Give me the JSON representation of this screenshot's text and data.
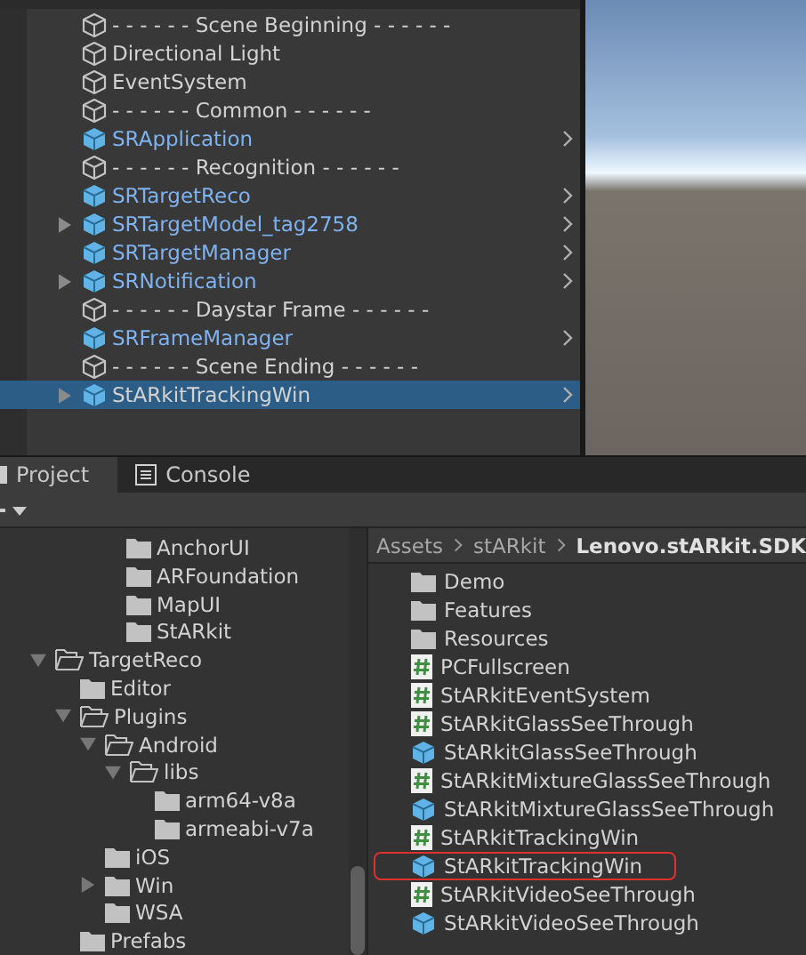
{
  "hierarchy": {
    "items": [
      {
        "label": "- - - - - - Scene Beginning - - - - - -",
        "kind": "object",
        "has_children": false,
        "selected": false
      },
      {
        "label": "Directional Light",
        "kind": "object",
        "has_children": false,
        "selected": false
      },
      {
        "label": "EventSystem",
        "kind": "object",
        "has_children": false,
        "selected": false
      },
      {
        "label": "- - - - - - Common - - - - - -",
        "kind": "object",
        "has_children": false,
        "selected": false
      },
      {
        "label": "SRApplication",
        "kind": "prefab",
        "has_children": false,
        "selected": false
      },
      {
        "label": "- - - - - - Recognition - - - - - -",
        "kind": "object",
        "has_children": false,
        "selected": false
      },
      {
        "label": "SRTargetReco",
        "kind": "prefab",
        "has_children": false,
        "selected": false
      },
      {
        "label": "SRTargetModel_tag2758",
        "kind": "prefab",
        "has_children": true,
        "selected": false
      },
      {
        "label": "SRTargetManager",
        "kind": "prefab",
        "has_children": false,
        "selected": false
      },
      {
        "label": "SRNotification",
        "kind": "prefab",
        "has_children": true,
        "selected": false
      },
      {
        "label": "- - - - - - Daystar Frame - - - - - -",
        "kind": "object",
        "has_children": false,
        "selected": false
      },
      {
        "label": "SRFrameManager",
        "kind": "prefab",
        "has_children": false,
        "selected": false
      },
      {
        "label": "- - - - - - Scene Ending - - - - - -",
        "kind": "object",
        "has_children": false,
        "selected": false
      },
      {
        "label": "StARkitTrackingWin",
        "kind": "prefab",
        "has_children": true,
        "selected": true
      }
    ]
  },
  "tabs": [
    {
      "label": "Project",
      "selected": true
    },
    {
      "label": "Console",
      "selected": false
    }
  ],
  "folder_tree": [
    {
      "label": "AnchorUI",
      "expanded": false,
      "has_children": false
    },
    {
      "label": "ARFoundation",
      "expanded": false,
      "has_children": false
    },
    {
      "label": "MapUI",
      "expanded": false,
      "has_children": false
    },
    {
      "label": "StARkit",
      "expanded": false,
      "has_children": false
    },
    {
      "label": "TargetReco",
      "expanded": true,
      "has_children": true,
      "outdent": true,
      "children": [
        {
          "label": "Editor",
          "expanded": false,
          "has_children": false
        },
        {
          "label": "Plugins",
          "expanded": true,
          "has_children": true,
          "children": [
            {
              "label": "Android",
              "expanded": true,
              "has_children": true,
              "children": [
                {
                  "label": "libs",
                  "expanded": true,
                  "has_children": true,
                  "children": [
                    {
                      "label": "arm64-v8a",
                      "expanded": false,
                      "has_children": false
                    },
                    {
                      "label": "armeabi-v7a",
                      "expanded": false,
                      "has_children": false
                    }
                  ]
                }
              ]
            },
            {
              "label": "iOS",
              "expanded": false,
              "has_children": false
            },
            {
              "label": "Win",
              "expanded": false,
              "has_children": true
            },
            {
              "label": "WSA",
              "expanded": false,
              "has_children": false
            }
          ]
        },
        {
          "label": "Prefabs",
          "expanded": false,
          "has_children": false
        }
      ]
    }
  ],
  "breadcrumb": [
    {
      "label": "Assets",
      "current": false
    },
    {
      "label": "stARkit",
      "current": false
    },
    {
      "label": "Lenovo.stARkit.SDK",
      "current": true
    }
  ],
  "files": [
    {
      "label": "Demo",
      "kind": "folder",
      "highlighted": false
    },
    {
      "label": "Features",
      "kind": "folder",
      "highlighted": false
    },
    {
      "label": "Resources",
      "kind": "folder",
      "highlighted": false
    },
    {
      "label": "PCFullscreen",
      "kind": "script",
      "highlighted": false
    },
    {
      "label": "StARkitEventSystem",
      "kind": "script",
      "highlighted": false
    },
    {
      "label": "StARkitGlassSeeThrough",
      "kind": "script",
      "highlighted": false
    },
    {
      "label": "StARkitGlassSeeThrough",
      "kind": "prefab",
      "highlighted": false
    },
    {
      "label": "StARkitMixtureGlassSeeThrough",
      "kind": "script",
      "highlighted": false
    },
    {
      "label": "StARkitMixtureGlassSeeThrough",
      "kind": "prefab",
      "highlighted": false
    },
    {
      "label": "StARkitTrackingWin",
      "kind": "script",
      "highlighted": false
    },
    {
      "label": "StARkitTrackingWin",
      "kind": "prefab",
      "highlighted": true
    },
    {
      "label": "StARkitVideoSeeThrough",
      "kind": "script",
      "highlighted": false
    },
    {
      "label": "StARkitVideoSeeThrough",
      "kind": "prefab",
      "highlighted": false
    }
  ]
}
